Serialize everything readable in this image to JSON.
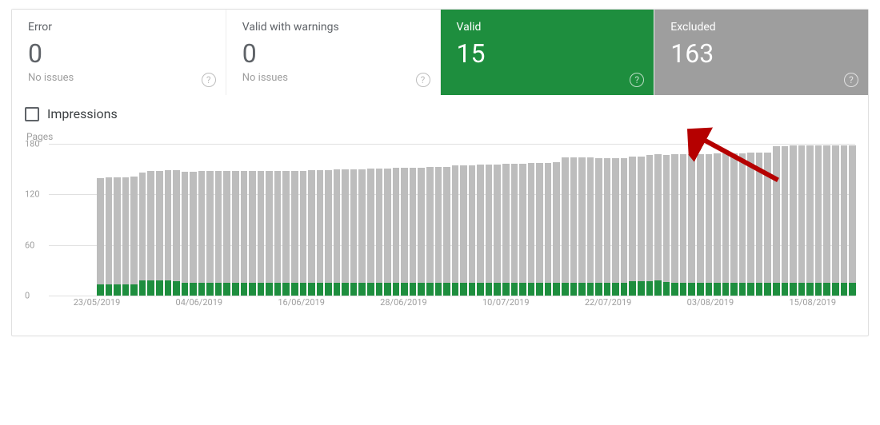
{
  "cards": {
    "error": {
      "title": "Error",
      "value": "0",
      "sub": "No issues"
    },
    "warnings": {
      "title": "Valid with warnings",
      "value": "0",
      "sub": "No issues"
    },
    "valid": {
      "title": "Valid",
      "value": "15",
      "sub": ""
    },
    "excluded": {
      "title": "Excluded",
      "value": "163",
      "sub": ""
    }
  },
  "impressions": {
    "label": "Impressions",
    "checked": false
  },
  "chart_data": {
    "type": "bar",
    "title": "",
    "ylabel": "Pages",
    "ylim": [
      0,
      180
    ],
    "yticks": [
      0,
      60,
      120,
      180
    ],
    "xticks": [
      "23/05/2019",
      "04/06/2019",
      "16/06/2019",
      "28/06/2019",
      "10/07/2019",
      "22/07/2019",
      "03/08/2019",
      "15/08/2019"
    ],
    "categories": [
      "23/05/2019",
      "24/05/2019",
      "25/05/2019",
      "26/05/2019",
      "27/05/2019",
      "28/05/2019",
      "29/05/2019",
      "30/05/2019",
      "31/05/2019",
      "01/06/2019",
      "02/06/2019",
      "03/06/2019",
      "04/06/2019",
      "05/06/2019",
      "06/06/2019",
      "07/06/2019",
      "08/06/2019",
      "09/06/2019",
      "10/06/2019",
      "11/06/2019",
      "12/06/2019",
      "13/06/2019",
      "14/06/2019",
      "15/06/2019",
      "16/06/2019",
      "17/06/2019",
      "18/06/2019",
      "19/06/2019",
      "20/06/2019",
      "21/06/2019",
      "22/06/2019",
      "23/06/2019",
      "24/06/2019",
      "25/06/2019",
      "26/06/2019",
      "27/06/2019",
      "28/06/2019",
      "29/06/2019",
      "30/06/2019",
      "01/07/2019",
      "02/07/2019",
      "03/07/2019",
      "04/07/2019",
      "05/07/2019",
      "06/07/2019",
      "07/07/2019",
      "08/07/2019",
      "09/07/2019",
      "10/07/2019",
      "11/07/2019",
      "12/07/2019",
      "13/07/2019",
      "14/07/2019",
      "15/07/2019",
      "16/07/2019",
      "17/07/2019",
      "18/07/2019",
      "19/07/2019",
      "20/07/2019",
      "21/07/2019",
      "22/07/2019",
      "23/07/2019",
      "24/07/2019",
      "25/07/2019",
      "26/07/2019",
      "27/07/2019",
      "28/07/2019",
      "29/07/2019",
      "30/07/2019",
      "31/07/2019",
      "01/08/2019",
      "02/08/2019",
      "03/08/2019",
      "04/08/2019",
      "05/08/2019",
      "06/08/2019",
      "07/08/2019",
      "08/08/2019",
      "09/08/2019",
      "10/08/2019",
      "11/08/2019",
      "12/08/2019",
      "13/08/2019",
      "14/08/2019",
      "15/08/2019",
      "16/08/2019",
      "17/08/2019",
      "18/08/2019",
      "19/08/2019",
      "20/08/2019"
    ],
    "series": [
      {
        "name": "Valid",
        "color": "#1e8e3e",
        "values": [
          13,
          13,
          13,
          13,
          13,
          18,
          18,
          18,
          18,
          17,
          15,
          15,
          15,
          15,
          15,
          15,
          15,
          15,
          15,
          15,
          15,
          15,
          15,
          15,
          15,
          15,
          15,
          15,
          15,
          15,
          15,
          15,
          15,
          15,
          15,
          15,
          15,
          15,
          15,
          15,
          15,
          15,
          15,
          15,
          15,
          15,
          15,
          15,
          15,
          15,
          15,
          15,
          15,
          15,
          15,
          15,
          15,
          15,
          15,
          15,
          15,
          15,
          15,
          17,
          17,
          17,
          18,
          16,
          15,
          15,
          15,
          15,
          15,
          15,
          15,
          15,
          15,
          15,
          15,
          15,
          15,
          15,
          15,
          15,
          15,
          15,
          15,
          15,
          15,
          15
        ]
      },
      {
        "name": "Excluded",
        "color": "#bdbdbd",
        "values": [
          126,
          127,
          127,
          127,
          128,
          128,
          130,
          130,
          131,
          132,
          132,
          132,
          133,
          133,
          133,
          133,
          133,
          133,
          133,
          133,
          133,
          133,
          133,
          133,
          133,
          134,
          134,
          134,
          135,
          135,
          135,
          135,
          136,
          136,
          136,
          137,
          137,
          137,
          137,
          138,
          138,
          138,
          139,
          139,
          139,
          140,
          140,
          140,
          141,
          141,
          141,
          142,
          142,
          142,
          143,
          149,
          149,
          149,
          149,
          148,
          148,
          148,
          148,
          148,
          148,
          150,
          150,
          151,
          153,
          153,
          153,
          153,
          153,
          154,
          154,
          154,
          154,
          155,
          155,
          155,
          162,
          162,
          163,
          163,
          163,
          163,
          163,
          163,
          163,
          163
        ]
      }
    ]
  }
}
